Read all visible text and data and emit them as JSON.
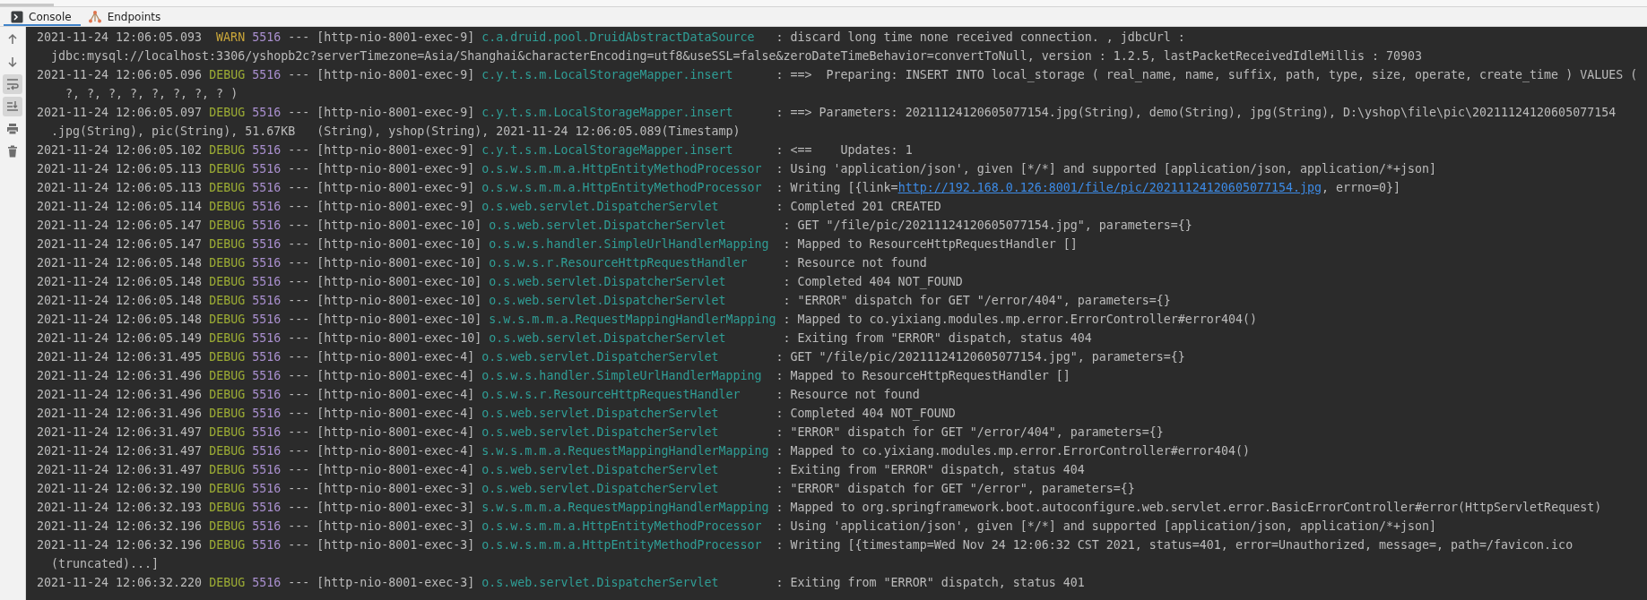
{
  "tabs": [
    {
      "label": "Console",
      "kind": "console",
      "selected": true
    },
    {
      "label": "Endpoints",
      "kind": "endpoints",
      "selected": false
    }
  ],
  "toolbar": [
    {
      "kind": "up",
      "on": false
    },
    {
      "kind": "down",
      "on": false
    },
    {
      "kind": "wrap",
      "on": true
    },
    {
      "kind": "scroll-end",
      "on": true
    },
    {
      "kind": "print",
      "on": false
    },
    {
      "kind": "trash",
      "on": false
    }
  ],
  "log": [
    {
      "time": "2021-11-24 12:06:05.093",
      "level": "WARN",
      "pid": "5516",
      "sep": "---",
      "thread": "[http-nio-8001-exec-9]",
      "logger": "c.a.druid.pool.DruidAbstractDataSource",
      "message": ": discard long time none received connection. , jdbcUrl :",
      "continuation": "jdbc:mysql://localhost:3306/yshopb2c?serverTimezone=Asia/Shanghai&characterEncoding=utf8&useSSL=false&zeroDateTimeBehavior=convertToNull, version : 1.2.5, lastPacketReceivedIdleMillis : 70903"
    },
    {
      "time": "2021-11-24 12:06:05.096",
      "level": "DEBUG",
      "pid": "5516",
      "sep": "---",
      "thread": "[http-nio-8001-exec-9]",
      "logger": "c.y.t.s.m.LocalStorageMapper.insert",
      "message": ": ==>  Preparing: INSERT INTO local_storage ( real_name, name, suffix, path, type, size, operate, create_time ) VALUES (",
      "continuation": "  ?, ?, ?, ?, ?, ?, ?, ? )"
    },
    {
      "time": "2021-11-24 12:06:05.097",
      "level": "DEBUG",
      "pid": "5516",
      "sep": "---",
      "thread": "[http-nio-8001-exec-9]",
      "logger": "c.y.t.s.m.LocalStorageMapper.insert",
      "message": ": ==> Parameters: 20211124120605077154.jpg(String), demo(String), jpg(String), D:\\yshop\\file\\pic\\20211124120605077154",
      "continuation": ".jpg(String), pic(String), 51.67KB   (String), yshop(String), 2021-11-24 12:06:05.089(Timestamp)"
    },
    {
      "time": "2021-11-24 12:06:05.102",
      "level": "DEBUG",
      "pid": "5516",
      "sep": "---",
      "thread": "[http-nio-8001-exec-9]",
      "logger": "c.y.t.s.m.LocalStorageMapper.insert",
      "message": ": <==    Updates: 1"
    },
    {
      "time": "2021-11-24 12:06:05.113",
      "level": "DEBUG",
      "pid": "5516",
      "sep": "---",
      "thread": "[http-nio-8001-exec-9]",
      "logger": "o.s.w.s.m.m.a.HttpEntityMethodProcessor",
      "message": ": Using 'application/json', given [*/*] and supported [application/json, application/*+json]"
    },
    {
      "time": "2021-11-24 12:06:05.113",
      "level": "DEBUG",
      "pid": "5516",
      "sep": "---",
      "thread": "[http-nio-8001-exec-9]",
      "logger": "o.s.w.s.m.m.a.HttpEntityMethodProcessor",
      "message": ": Writing [{link=",
      "link": "http://192.168.0.126:8001/file/pic/20211124120605077154.jpg",
      "after": ", errno=0}]"
    },
    {
      "time": "2021-11-24 12:06:05.114",
      "level": "DEBUG",
      "pid": "5516",
      "sep": "---",
      "thread": "[http-nio-8001-exec-9]",
      "logger": "o.s.web.servlet.DispatcherServlet",
      "message": ": Completed 201 CREATED"
    },
    {
      "time": "2021-11-24 12:06:05.147",
      "level": "DEBUG",
      "pid": "5516",
      "sep": "---",
      "thread": "[http-nio-8001-exec-10]",
      "logger": "o.s.web.servlet.DispatcherServlet",
      "message": ": GET \"/file/pic/20211124120605077154.jpg\", parameters={}"
    },
    {
      "time": "2021-11-24 12:06:05.147",
      "level": "DEBUG",
      "pid": "5516",
      "sep": "---",
      "thread": "[http-nio-8001-exec-10]",
      "logger": "o.s.w.s.handler.SimpleUrlHandlerMapping",
      "message": ": Mapped to ResourceHttpRequestHandler []"
    },
    {
      "time": "2021-11-24 12:06:05.148",
      "level": "DEBUG",
      "pid": "5516",
      "sep": "---",
      "thread": "[http-nio-8001-exec-10]",
      "logger": "o.s.w.s.r.ResourceHttpRequestHandler",
      "message": ": Resource not found"
    },
    {
      "time": "2021-11-24 12:06:05.148",
      "level": "DEBUG",
      "pid": "5516",
      "sep": "---",
      "thread": "[http-nio-8001-exec-10]",
      "logger": "o.s.web.servlet.DispatcherServlet",
      "message": ": Completed 404 NOT_FOUND"
    },
    {
      "time": "2021-11-24 12:06:05.148",
      "level": "DEBUG",
      "pid": "5516",
      "sep": "---",
      "thread": "[http-nio-8001-exec-10]",
      "logger": "o.s.web.servlet.DispatcherServlet",
      "message": ": \"ERROR\" dispatch for GET \"/error/404\", parameters={}"
    },
    {
      "time": "2021-11-24 12:06:05.148",
      "level": "DEBUG",
      "pid": "5516",
      "sep": "---",
      "thread": "[http-nio-8001-exec-10]",
      "logger": "s.w.s.m.m.a.RequestMappingHandlerMapping",
      "message": ": Mapped to co.yixiang.modules.mp.error.ErrorController#error404()"
    },
    {
      "time": "2021-11-24 12:06:05.149",
      "level": "DEBUG",
      "pid": "5516",
      "sep": "---",
      "thread": "[http-nio-8001-exec-10]",
      "logger": "o.s.web.servlet.DispatcherServlet",
      "message": ": Exiting from \"ERROR\" dispatch, status 404"
    },
    {
      "time": "2021-11-24 12:06:31.495",
      "level": "DEBUG",
      "pid": "5516",
      "sep": "---",
      "thread": "[http-nio-8001-exec-4]",
      "logger": "o.s.web.servlet.DispatcherServlet",
      "message": ": GET \"/file/pic/20211124120605077154.jpg\", parameters={}"
    },
    {
      "time": "2021-11-24 12:06:31.496",
      "level": "DEBUG",
      "pid": "5516",
      "sep": "---",
      "thread": "[http-nio-8001-exec-4]",
      "logger": "o.s.w.s.handler.SimpleUrlHandlerMapping",
      "message": ": Mapped to ResourceHttpRequestHandler []"
    },
    {
      "time": "2021-11-24 12:06:31.496",
      "level": "DEBUG",
      "pid": "5516",
      "sep": "---",
      "thread": "[http-nio-8001-exec-4]",
      "logger": "o.s.w.s.r.ResourceHttpRequestHandler",
      "message": ": Resource not found"
    },
    {
      "time": "2021-11-24 12:06:31.496",
      "level": "DEBUG",
      "pid": "5516",
      "sep": "---",
      "thread": "[http-nio-8001-exec-4]",
      "logger": "o.s.web.servlet.DispatcherServlet",
      "message": ": Completed 404 NOT_FOUND"
    },
    {
      "time": "2021-11-24 12:06:31.497",
      "level": "DEBUG",
      "pid": "5516",
      "sep": "---",
      "thread": "[http-nio-8001-exec-4]",
      "logger": "o.s.web.servlet.DispatcherServlet",
      "message": ": \"ERROR\" dispatch for GET \"/error/404\", parameters={}"
    },
    {
      "time": "2021-11-24 12:06:31.497",
      "level": "DEBUG",
      "pid": "5516",
      "sep": "---",
      "thread": "[http-nio-8001-exec-4]",
      "logger": "s.w.s.m.m.a.RequestMappingHandlerMapping",
      "message": ": Mapped to co.yixiang.modules.mp.error.ErrorController#error404()"
    },
    {
      "time": "2021-11-24 12:06:31.497",
      "level": "DEBUG",
      "pid": "5516",
      "sep": "---",
      "thread": "[http-nio-8001-exec-4]",
      "logger": "o.s.web.servlet.DispatcherServlet",
      "message": ": Exiting from \"ERROR\" dispatch, status 404"
    },
    {
      "time": "2021-11-24 12:06:32.190",
      "level": "DEBUG",
      "pid": "5516",
      "sep": "---",
      "thread": "[http-nio-8001-exec-3]",
      "logger": "o.s.web.servlet.DispatcherServlet",
      "message": ": \"ERROR\" dispatch for GET \"/error\", parameters={}"
    },
    {
      "time": "2021-11-24 12:06:32.193",
      "level": "DEBUG",
      "pid": "5516",
      "sep": "---",
      "thread": "[http-nio-8001-exec-3]",
      "logger": "s.w.s.m.m.a.RequestMappingHandlerMapping",
      "message": ": Mapped to org.springframework.boot.autoconfigure.web.servlet.error.BasicErrorController#error(HttpServletRequest)"
    },
    {
      "time": "2021-11-24 12:06:32.196",
      "level": "DEBUG",
      "pid": "5516",
      "sep": "---",
      "thread": "[http-nio-8001-exec-3]",
      "logger": "o.s.w.s.m.m.a.HttpEntityMethodProcessor",
      "message": ": Using 'application/json', given [*/*] and supported [application/json, application/*+json]"
    },
    {
      "time": "2021-11-24 12:06:32.196",
      "level": "DEBUG",
      "pid": "5516",
      "sep": "---",
      "thread": "[http-nio-8001-exec-3]",
      "logger": "o.s.w.s.m.m.a.HttpEntityMethodProcessor",
      "message": ": Writing [{timestamp=Wed Nov 24 12:06:32 CST 2021, status=401, error=Unauthorized, message=, path=/favicon.ico",
      "continuation": "(truncated)...]"
    },
    {
      "time": "2021-11-24 12:06:32.220",
      "level": "DEBUG",
      "pid": "5516",
      "sep": "---",
      "thread": "[http-nio-8001-exec-3]",
      "logger": "o.s.web.servlet.DispatcherServlet",
      "message": ": Exiting from \"ERROR\" dispatch, status 401"
    }
  ]
}
